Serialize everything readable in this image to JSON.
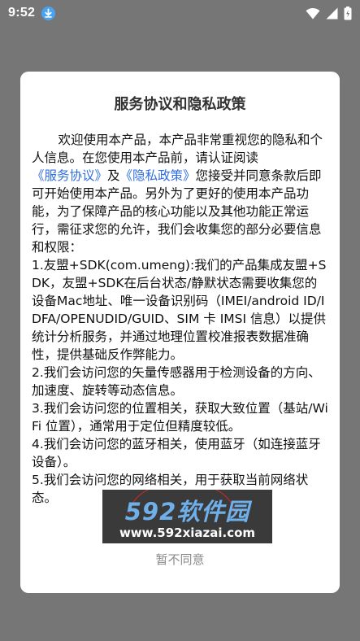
{
  "status_bar": {
    "time": "9:52"
  },
  "dialog": {
    "title": "服务协议和隐私政策",
    "intro_pre": "欢迎使用本产品，本产品非常重视您的隐私和个人信息。在您使用本产品前，请认证阅读",
    "link_service": "《服务协议》",
    "intro_and": "及",
    "link_privacy": "《隐私政策》",
    "intro_post": "您接受并同意条款后即可开始使用本产品。另外为了更好的使用本产品功能，为了保障产品的核心功能以及其他功能正常运行，需征求您的允许，我们会收集您的部分必要信息和权限：",
    "items": [
      "1.友盟+SDK(com.umeng):我们的产品集成友盟+SDK，友盟+SDK在后台状态/静默状态需要收集您的设备Mac地址、唯一设备识别码（IMEI/android ID/IDFA/OPENUDID/GUID、SIM 卡 IMSI 信息）以提供统计分析服务，并通过地理位置校准报表数据准确性，提供基础反作弊能力。",
      "2.我们会访问您的矢量传感器用于检测设备的方向、加速度、旋转等动态信息。",
      "3.我们会访问您的位置相关，获取大致位置（基站/WiFi 位置），通常用于定位但精度较低。",
      "4.我们会访问您的蓝牙相关，使用蓝牙（如连接蓝牙设备）。",
      "5.我们会访问您的网络相关，用于获取当前网络状态。"
    ],
    "disagree_label": "暂不同意"
  },
  "watermark": {
    "brand": "592软件园",
    "url": "www.592xiazai.com"
  },
  "colors": {
    "link": "#2f6ee0",
    "overlay": "#767676",
    "watermark_brand": "#6fb0ea"
  },
  "icons": [
    "download-icon",
    "wifi-icon",
    "signal-icon",
    "battery-icon"
  ]
}
